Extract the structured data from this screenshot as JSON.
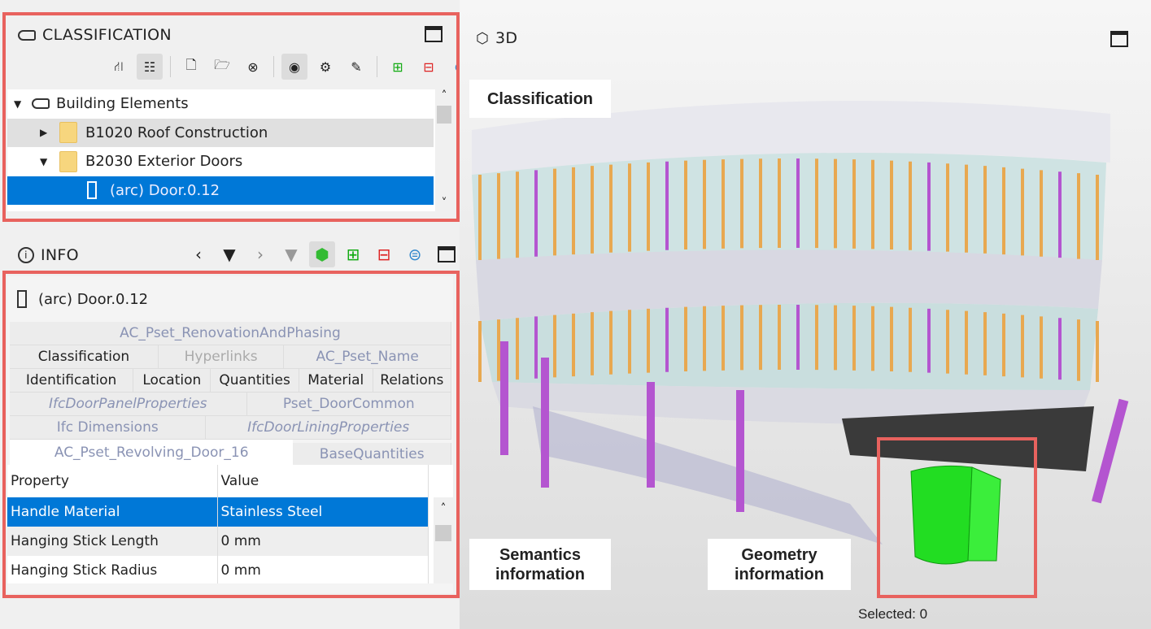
{
  "classification": {
    "title": "CLASSIFICATION",
    "tree": [
      {
        "label": "Building Elements",
        "expanded": true
      },
      {
        "label": "B1020 Roof Construction",
        "expanded": false
      },
      {
        "label": "B2030 Exterior Doors",
        "expanded": true
      },
      {
        "label": "(arc) Door.0.12",
        "selected": true
      }
    ],
    "toolbar": [
      "tree-branch-icon",
      "tree-list-icon",
      "new-file-icon",
      "open-folder-icon",
      "close-circle-icon",
      "hide-eye-icon",
      "gear-icon",
      "edit-document-icon",
      "bag-add-icon",
      "bag-remove-icon",
      "bag-equal-icon"
    ]
  },
  "info": {
    "title": "INFO",
    "element": "(arc) Door.0.12",
    "tab_rows": [
      [
        "AC_Pset_RenovationAndPhasing"
      ],
      [
        "Classification",
        "Hyperlinks",
        "AC_Pset_Name"
      ],
      [
        "Identification",
        "Location",
        "Quantities",
        "Material",
        "Relations"
      ],
      [
        "IfcDoorPanelProperties",
        "Pset_DoorCommon"
      ],
      [
        "Ifc Dimensions",
        "IfcDoorLiningProperties"
      ],
      [
        "AC_Pset_Revolving_Door_16",
        "BaseQuantities"
      ]
    ],
    "active_tab": "AC_Pset_Revolving_Door_16",
    "table": {
      "headers": [
        "Property",
        "Value"
      ],
      "rows": [
        [
          "Handle Material",
          "Stainless Steel"
        ],
        [
          "Hanging Stick Length",
          "0 mm"
        ],
        [
          "Hanging Stick Radius",
          "0 mm"
        ]
      ]
    }
  },
  "view3d": {
    "title": "3D",
    "status": "Selected: 0"
  },
  "annotations": {
    "classification": "Classification",
    "semantics": "Semantics information",
    "geometry": "Geometry information"
  },
  "colors": {
    "highlight": "#e8625e",
    "selection": "#0078d7",
    "selected_geometry": "#22dd22"
  }
}
